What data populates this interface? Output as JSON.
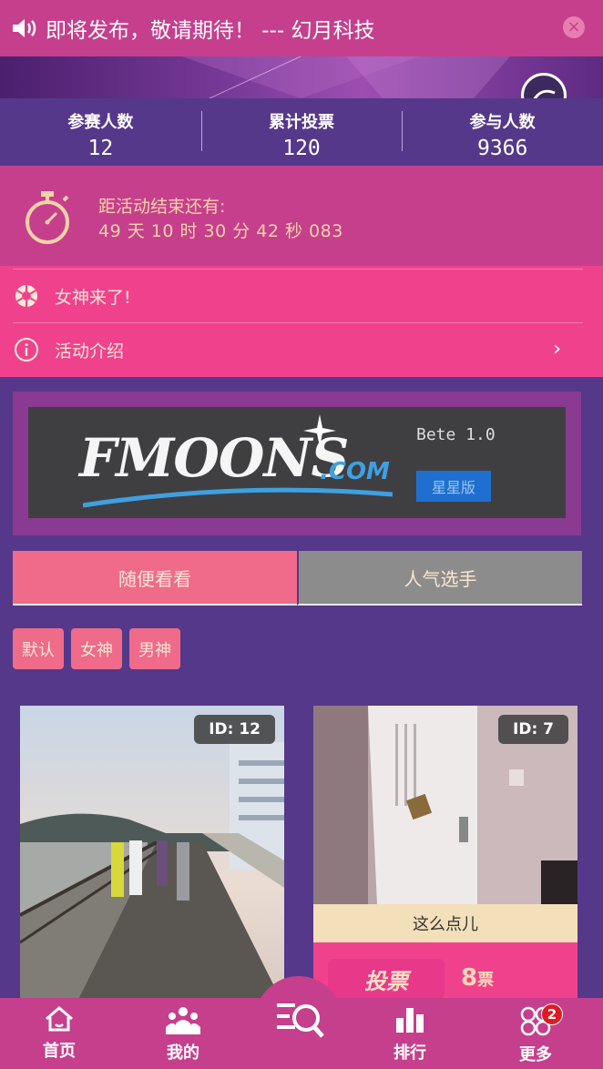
{
  "marquee": {
    "text": "即将发布，敬请期待！ --- 幻月科技"
  },
  "stats": [
    {
      "label": "参赛人数",
      "value": "12"
    },
    {
      "label": "累计投票",
      "value": "120"
    },
    {
      "label": "参与人数",
      "value": "9366"
    }
  ],
  "countdown": {
    "label": "距活动结束还有:",
    "time": "49 天 10 时 30 分 42 秒 083"
  },
  "menu": {
    "goddess": "女神来了!",
    "intro": "活动介绍",
    "arrow": "›"
  },
  "ad": {
    "logo": "FMOONS",
    "domain": ".COM",
    "version": "Bete 1.0",
    "badge": "星星版"
  },
  "tabs": {
    "random": "随便看看",
    "popular": "人气选手"
  },
  "filters": [
    "默认",
    "女神",
    "男神"
  ],
  "cards": [
    {
      "id": "ID: 12"
    },
    {
      "id": "ID: 7",
      "caption": "这么点儿",
      "vote_label": "投票",
      "vote_count": "8",
      "vote_unit": "票"
    }
  ],
  "tabbar": {
    "home": "首页",
    "mine": "我的",
    "ranking": "排行",
    "more": "更多",
    "more_badge": "2"
  },
  "colors": {
    "primary_pink": "#f0428c",
    "magenta": "#c63f8c",
    "purple_bg": "#55388a",
    "salmon": "#f06b8a"
  }
}
